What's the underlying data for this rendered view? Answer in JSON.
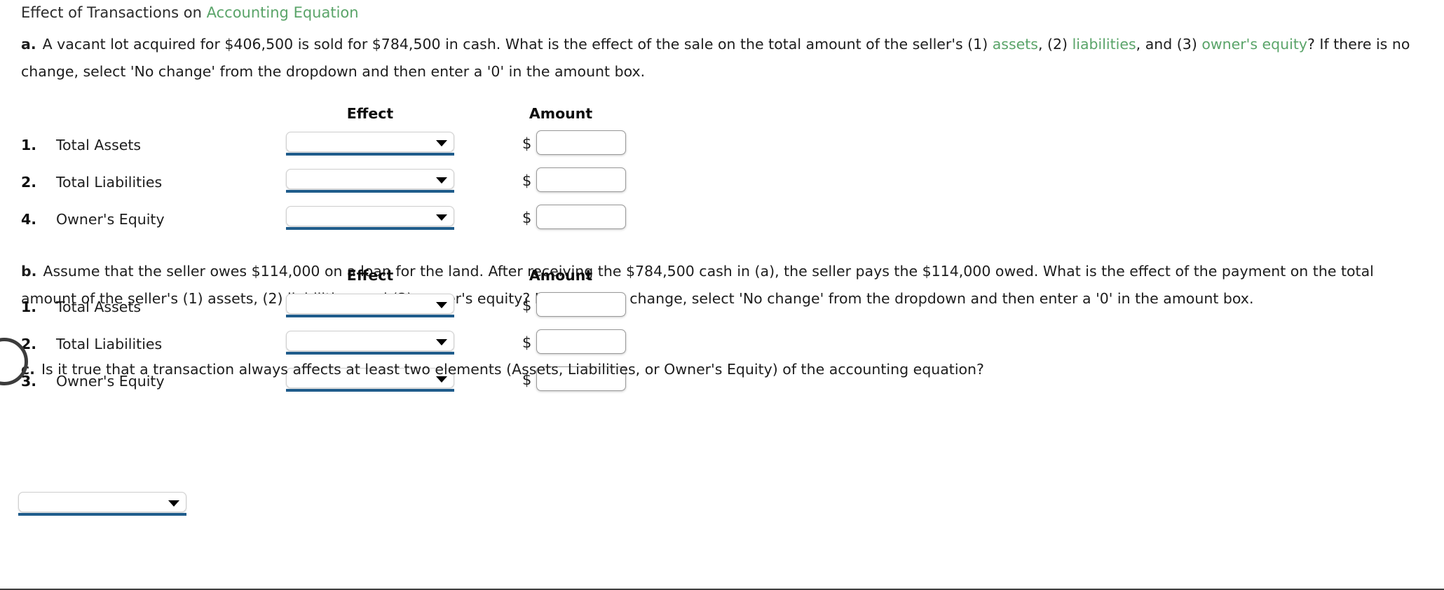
{
  "header": {
    "title_plain": "Effect of Transactions on ",
    "title_accent": "Accounting Equation"
  },
  "questions": {
    "a": {
      "letter": "a.",
      "segments": [
        {
          "text": "A vacant lot acquired for $406,500 is sold for $784,500 in cash. What is the effect of the sale on the total amount of the seller's (1) ",
          "style": "plain"
        },
        {
          "text": "assets",
          "style": "link"
        },
        {
          "text": ", (2) ",
          "style": "plain"
        },
        {
          "text": "liabilities",
          "style": "link"
        },
        {
          "text": ", and (3) ",
          "style": "plain"
        },
        {
          "text": "owner's equity",
          "style": "link"
        },
        {
          "text": "? If there is no change, select 'No change' from the dropdown and then enter a '0' in the amount box.",
          "style": "plain"
        }
      ],
      "full_text": "A vacant lot acquired for $406,500 is sold for $784,500 in cash. What is the effect of the sale on the total amount of the seller's (1) assets, (2) liabilities, and (3) owner's equity? If there is no change, select 'No change' from the dropdown and then enter a '0' in the amount box."
    },
    "b": {
      "letter": "b.",
      "full_text": "Assume that the seller owes $114,000 on a loan for the land. After receiving the $784,500 cash in (a), the seller pays the $114,000 owed. What is the effect of the payment on the total amount of the seller's (1) assets, (2) liabilities, and (3) owner's equity? If there is no change, select 'No change' from the dropdown and then enter a '0' in the amount box."
    },
    "c": {
      "letter": "c.",
      "full_text": "Is it true that a transaction always affects at least two elements (Assets, Liabilities, or Owner's Equity) of the accounting equation?"
    }
  },
  "table_a": {
    "columns": {
      "effect": "Effect",
      "amount": "Amount"
    },
    "rows": [
      {
        "num": "1.",
        "label": "Total Assets",
        "effect_value": "",
        "amount_value": "",
        "currency": "$"
      },
      {
        "num": "2.",
        "label": "Total Liabilities",
        "effect_value": "",
        "amount_value": "",
        "currency": "$"
      },
      {
        "num": "4.",
        "label": "Owner's Equity",
        "effect_value": "",
        "amount_value": "",
        "currency": "$"
      }
    ]
  },
  "table_b": {
    "columns": {
      "effect": "Effect",
      "amount": "Amount"
    },
    "rows": [
      {
        "num": "1.",
        "label": "Total Assets",
        "effect_value": "",
        "amount_value": "",
        "currency": "$"
      },
      {
        "num": "2.",
        "label": "Total Liabilities",
        "effect_value": "",
        "amount_value": "",
        "currency": "$"
      },
      {
        "num": "3.",
        "label": "Owner's Equity",
        "effect_value": "",
        "amount_value": "",
        "currency": "$"
      }
    ]
  },
  "question_c_select": {
    "value": ""
  },
  "colors": {
    "link_green": "#5aa469",
    "select_underline_blue": "#1f5c8b",
    "text": "#1d1d1d",
    "input_border": "#9a9a9a"
  }
}
